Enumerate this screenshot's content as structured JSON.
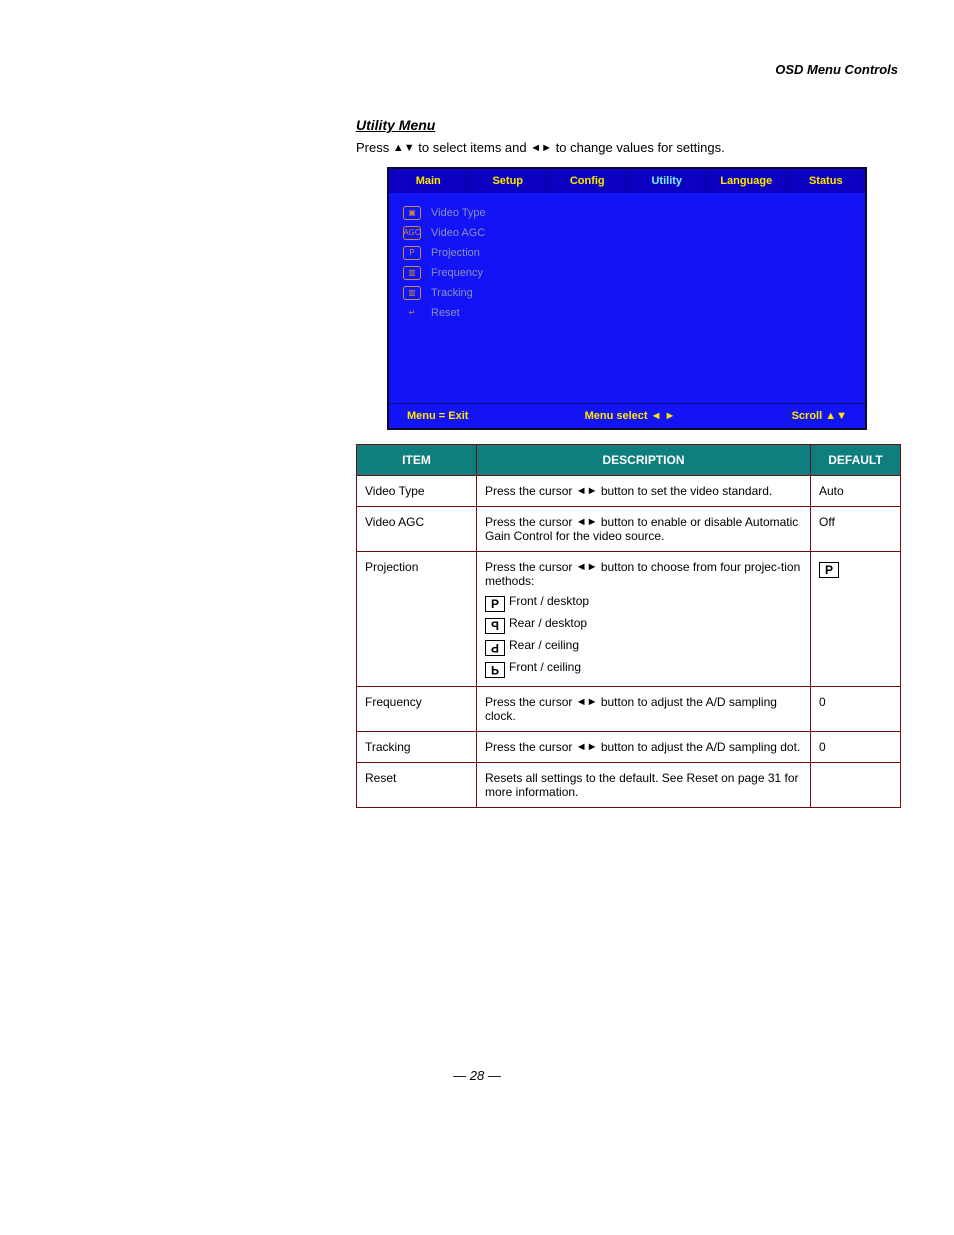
{
  "page_label": "OSD Menu Controls",
  "heading": "Utility Menu",
  "intro_prefix": "Press ",
  "intro_arrows_ud": "▲▼",
  "intro_mid": " to select items and ",
  "intro_arrows_lr": "◄►",
  "intro_suffix": " to change values for settings.",
  "osd": {
    "tabs": [
      "Main",
      "Setup",
      "Config",
      "Utility",
      "Language",
      "Status"
    ],
    "active_tab": "Utility",
    "items": [
      {
        "icon": "▣",
        "label": "Video Type"
      },
      {
        "icon": "AGC",
        "label": "Video AGC"
      },
      {
        "icon": "P",
        "label": "Projection"
      },
      {
        "icon": "▥",
        "label": "Frequency"
      },
      {
        "icon": "▥",
        "label": "Tracking"
      },
      {
        "icon": "↵",
        "label": "Reset"
      }
    ],
    "footer": {
      "exit": "Menu = Exit",
      "select": "Menu select  ◄ ►",
      "scroll": "Scroll  ▲▼"
    }
  },
  "table": {
    "headers": [
      "ITEM",
      "DESCRIPTION",
      "DEFAULT"
    ],
    "rows": [
      {
        "item": "Video Type",
        "desc_prefix": "Press the cursor ",
        "desc_arrows": "◄►",
        "desc_suffix": " button to set the video standard.",
        "default": "Auto"
      },
      {
        "item": "Video AGC",
        "desc_prefix": "Press the cursor ",
        "desc_arrows": "◄►",
        "desc_suffix": " button to enable or disable Automatic Gain Control for the video source.",
        "default": "Off"
      },
      {
        "item": "Projection",
        "desc_prefix": "Press the cursor ",
        "desc_arrows": "◄►",
        "desc_suffix": " button to choose from four projec-tion methods:",
        "options": [
          {
            "glyph": "P",
            "rot": "",
            "label": "Front / desktop"
          },
          {
            "glyph": "P",
            "rot": "r90",
            "label": "Rear / desktop"
          },
          {
            "glyph": "P",
            "rot": "r180",
            "label": "Rear / ceiling"
          },
          {
            "glyph": "P",
            "rot": "r270",
            "label": "Front / ceiling"
          }
        ],
        "default_icon": "P"
      },
      {
        "item": "Frequency",
        "desc_prefix": "Press the cursor ",
        "desc_arrows": "◄►",
        "desc_suffix": " button to adjust the A/D sampling clock.",
        "default": "0"
      },
      {
        "item": "Tracking",
        "desc_prefix": "Press the cursor ",
        "desc_arrows": "◄►",
        "desc_suffix": " button to adjust the A/D sampling dot.",
        "default": "0"
      },
      {
        "item": "Reset",
        "desc_plain": "Resets all settings to the default. See Reset on page 31 for more information.",
        "default": ""
      }
    ]
  },
  "page_number": "— 28 —"
}
